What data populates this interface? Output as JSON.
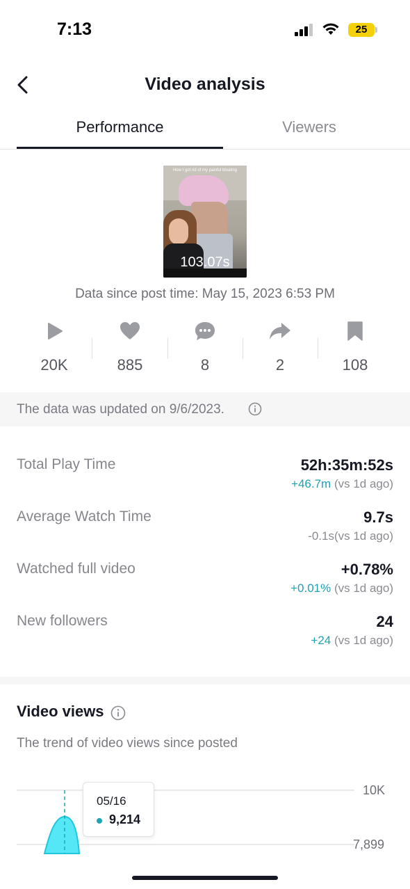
{
  "status_bar": {
    "time": "7:13",
    "battery": "25"
  },
  "header": {
    "title": "Video analysis"
  },
  "tabs": [
    {
      "label": "Performance",
      "active": true
    },
    {
      "label": "Viewers",
      "active": false
    }
  ],
  "video": {
    "caption": "How I got rid of my painful bloating",
    "duration": "103.07s",
    "since_text": "Data since post time: May 15, 2023 6:53 PM"
  },
  "stats": [
    {
      "icon": "play-icon",
      "value": "20K"
    },
    {
      "icon": "heart-icon",
      "value": "885"
    },
    {
      "icon": "comment-icon",
      "value": "8"
    },
    {
      "icon": "share-icon",
      "value": "2"
    },
    {
      "icon": "bookmark-icon",
      "value": "108"
    }
  ],
  "updated_text": "The data was updated on 9/6/2023.",
  "metrics": [
    {
      "label": "Total Play Time",
      "value": "52h:35m:52s",
      "delta": "+46.7m",
      "suffix": " (vs 1d ago)"
    },
    {
      "label": "Average Watch Time",
      "value": "9.7s",
      "delta": "-0.1s",
      "suffix": "(vs 1d ago)"
    },
    {
      "label": "Watched full video",
      "value": "+0.78%",
      "delta": "+0.01%",
      "suffix": " (vs 1d ago)"
    },
    {
      "label": "New followers",
      "value": "24",
      "delta": "+24",
      "suffix": " (vs 1d ago)"
    }
  ],
  "views": {
    "title": "Video views",
    "subtitle": "The trend of video views since posted"
  },
  "colors": {
    "accent": "#1ea2b3",
    "chart_fill": "#55e7f5"
  },
  "chart_data": {
    "type": "area",
    "x": [
      "05/16"
    ],
    "series": [
      {
        "values": [
          9214
        ]
      }
    ],
    "y_ticks": [
      "10K",
      "7,899"
    ],
    "tooltip": {
      "date": "05/16",
      "value": "9,214"
    }
  }
}
